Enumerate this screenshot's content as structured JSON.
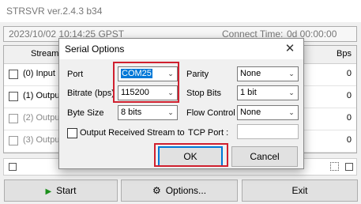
{
  "window": {
    "title": "STRSVR ver.2.4.3 b34"
  },
  "status": {
    "time": "2023/10/02 10:14:25 GPST",
    "connect_label": "Connect Time:",
    "connect_value": "0d 00:00:00"
  },
  "grid": {
    "headers": {
      "stream": "Stream",
      "bps": "Bps"
    },
    "rows": [
      {
        "label": "(0) Input",
        "bps": "0"
      },
      {
        "label": "(1) Output",
        "bps": "0"
      },
      {
        "label": "(2) Output",
        "bps": "0"
      },
      {
        "label": "(3) Output",
        "bps": "0"
      }
    ]
  },
  "buttons": {
    "start": "Start",
    "options": "Options...",
    "exit": "Exit",
    "start_icon": "play-icon",
    "options_icon": "gear-icon"
  },
  "dialog": {
    "title": "Serial Options",
    "close": "✕",
    "port_label": "Port",
    "port_value": "COM25",
    "bitrate_label": "Bitrate (bps)",
    "bitrate_value": "115200",
    "bytesize_label": "Byte Size",
    "bytesize_value": "8 bits",
    "parity_label": "Parity",
    "parity_value": "None",
    "stopbits_label": "Stop Bits",
    "stopbits_value": "1 bit",
    "flow_label": "Flow Control",
    "flow_value": "None",
    "output_received_label": "Output Received Stream to",
    "tcp_port_label": "TCP Port :",
    "tcp_port_value": "",
    "ok": "OK",
    "cancel": "Cancel"
  },
  "colors": {
    "highlight": "#d0202f",
    "selection": "#0078d7",
    "start_icon": "#1a8f1a"
  }
}
